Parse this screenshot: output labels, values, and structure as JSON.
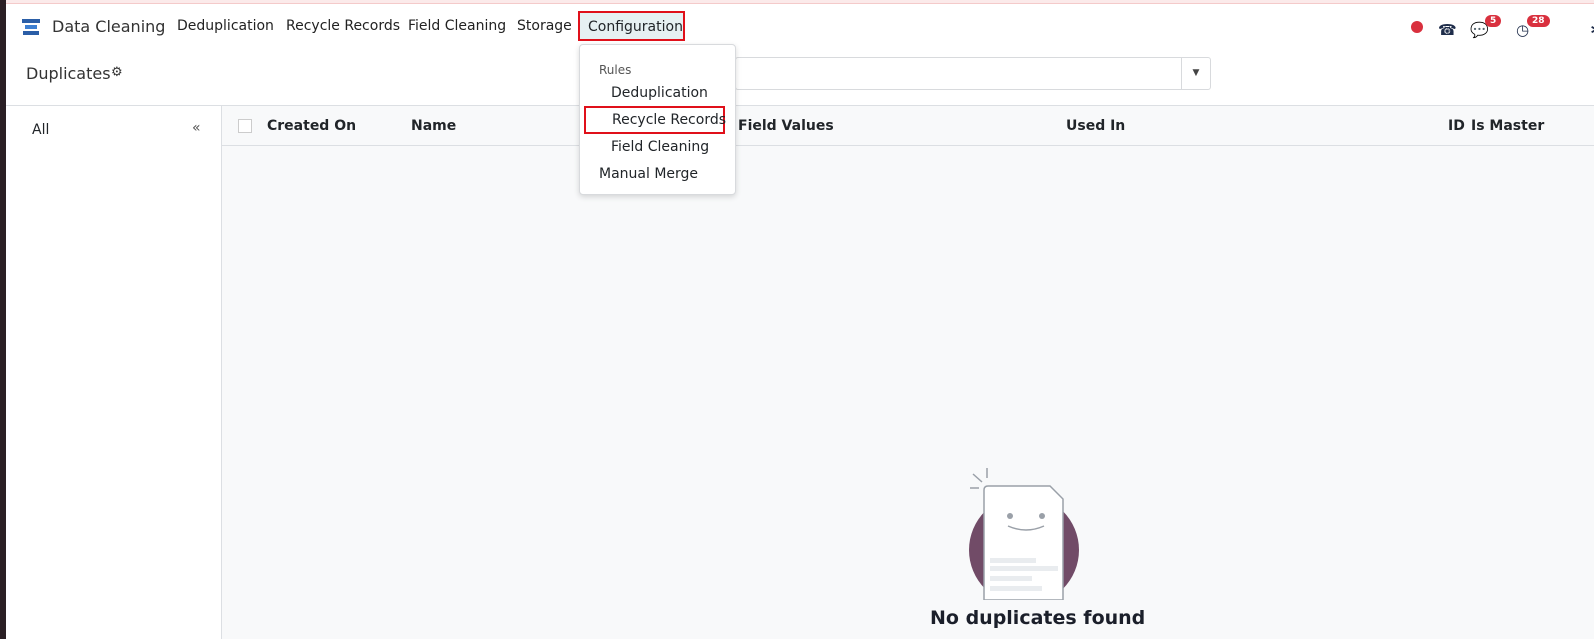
{
  "app": {
    "name": "Data Cleaning"
  },
  "nav": {
    "items": [
      "Deduplication",
      "Recycle Records",
      "Field Cleaning",
      "Storage"
    ],
    "active": "Configuration"
  },
  "systray": {
    "messages_count": "5",
    "activities_count": "28"
  },
  "page": {
    "title": "Duplicates"
  },
  "sidebar": {
    "all": "All",
    "collapse": "«"
  },
  "table": {
    "columns": [
      "Created On",
      "Name",
      "Field Values",
      "Used In",
      "ID",
      "Is Master"
    ]
  },
  "dropdown": {
    "section": "Rules",
    "items": [
      "Deduplication",
      "Recycle Records",
      "Field Cleaning"
    ],
    "manual": "Manual Merge"
  },
  "empty": {
    "message": "No duplicates found"
  },
  "colors": {
    "accent": "#714b67",
    "highlight": "#e0101a",
    "badge": "#d9303e"
  }
}
